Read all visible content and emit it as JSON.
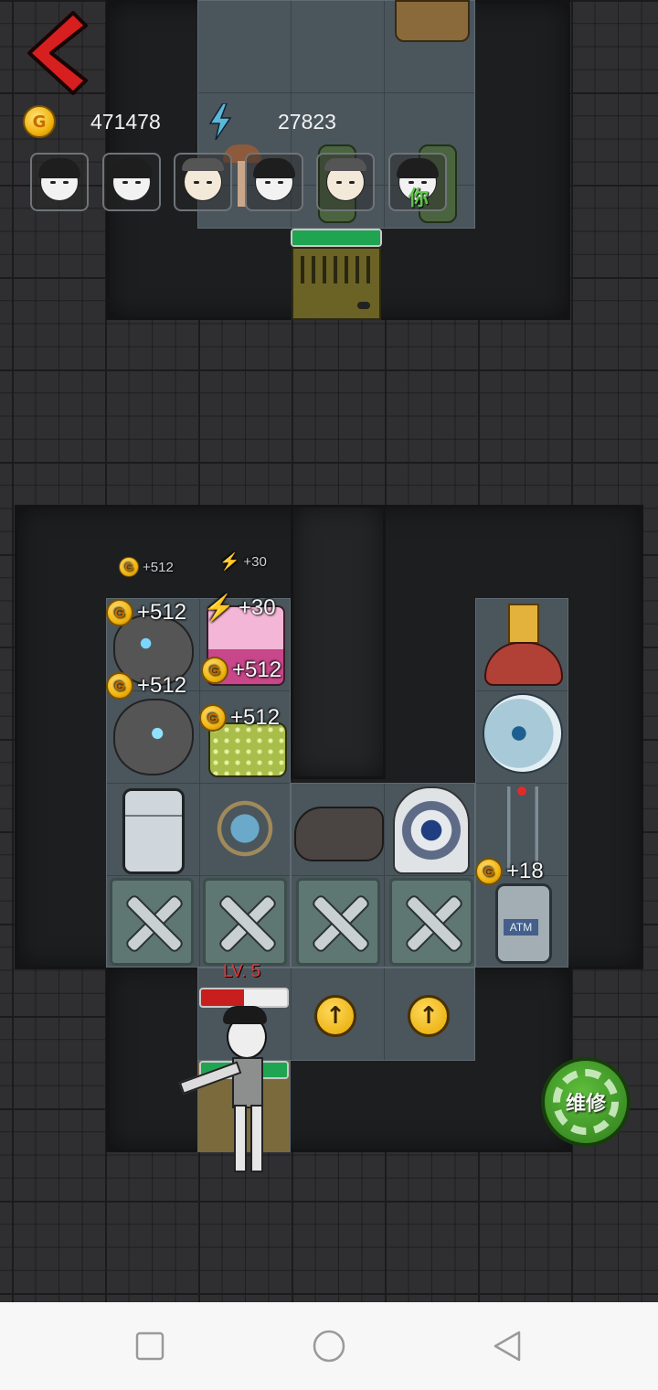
{
  "hud": {
    "gold": "471478",
    "energy": "27823",
    "coin_letter": "G",
    "avatars": [
      {
        "label": ""
      },
      {
        "label": ""
      },
      {
        "label": ""
      },
      {
        "label": ""
      },
      {
        "label": ""
      },
      {
        "label": "你"
      }
    ]
  },
  "popups": {
    "small_gold": "+512",
    "small_energy": "+30",
    "gold_a": "+512",
    "energy_a": "+30",
    "gold_b": "+512",
    "gold_c": "+512",
    "gold_d": "+512",
    "gold_atm": "+18"
  },
  "player": {
    "level_label": "LV. 5",
    "health_fraction": 0.5
  },
  "door": {
    "health_fraction": 1.0
  },
  "actions": {
    "repair_label": "维修"
  },
  "colors": {
    "health_red": "#c81e1e",
    "door_green": "#1fa552",
    "coin_gold": "#f1b40f",
    "energy_blue": "#5bb8d8",
    "repair_green": "#3d9c26"
  },
  "icons": {
    "back": "chevron-left-icon",
    "gold": "gold-coin-icon",
    "energy": "lightning-icon",
    "upgrade": "arrow-up-icon",
    "repair": "gear-wrench-icon",
    "nav_recent": "square-icon",
    "nav_home": "circle-icon",
    "nav_back": "triangle-back-icon"
  }
}
